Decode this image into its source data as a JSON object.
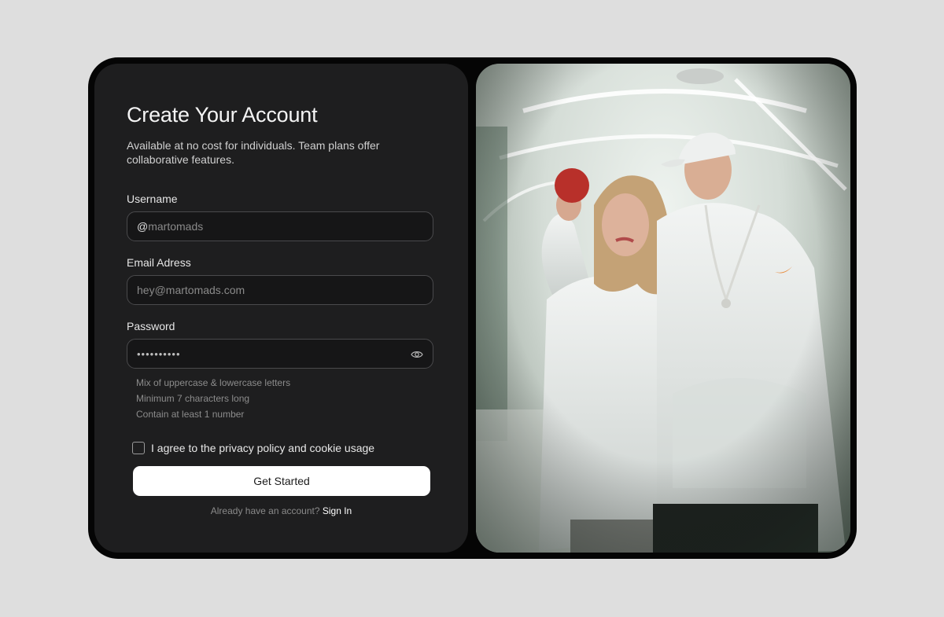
{
  "form": {
    "title": "Create Your Account",
    "subtitle": "Available at no cost for individuals. Team plans offer collaborative features.",
    "username": {
      "label": "Username",
      "prefix": "@",
      "placeholder": "martomads"
    },
    "email": {
      "label": "Email Adress",
      "placeholder": "hey@martomads.com"
    },
    "password": {
      "label": "Password",
      "value": "••••••••••",
      "toggle_icon": "eye-icon"
    },
    "hints": [
      "Mix of uppercase & lowercase letters",
      "Minimum 7 characters long",
      "Contain at least 1 number"
    ],
    "agree_text": "I agree to the privacy policy and cookie usage",
    "cta_label": "Get Started",
    "signin_prompt": "Already have an account?",
    "signin_link": "Sign In"
  },
  "photo": {
    "brand_mark": "swoosh"
  },
  "colors": {
    "page_bg": "#dedede",
    "frame": "#050505",
    "panel": "#1e1e1f",
    "field_bg": "#161617",
    "cta_bg": "#ffffff"
  }
}
